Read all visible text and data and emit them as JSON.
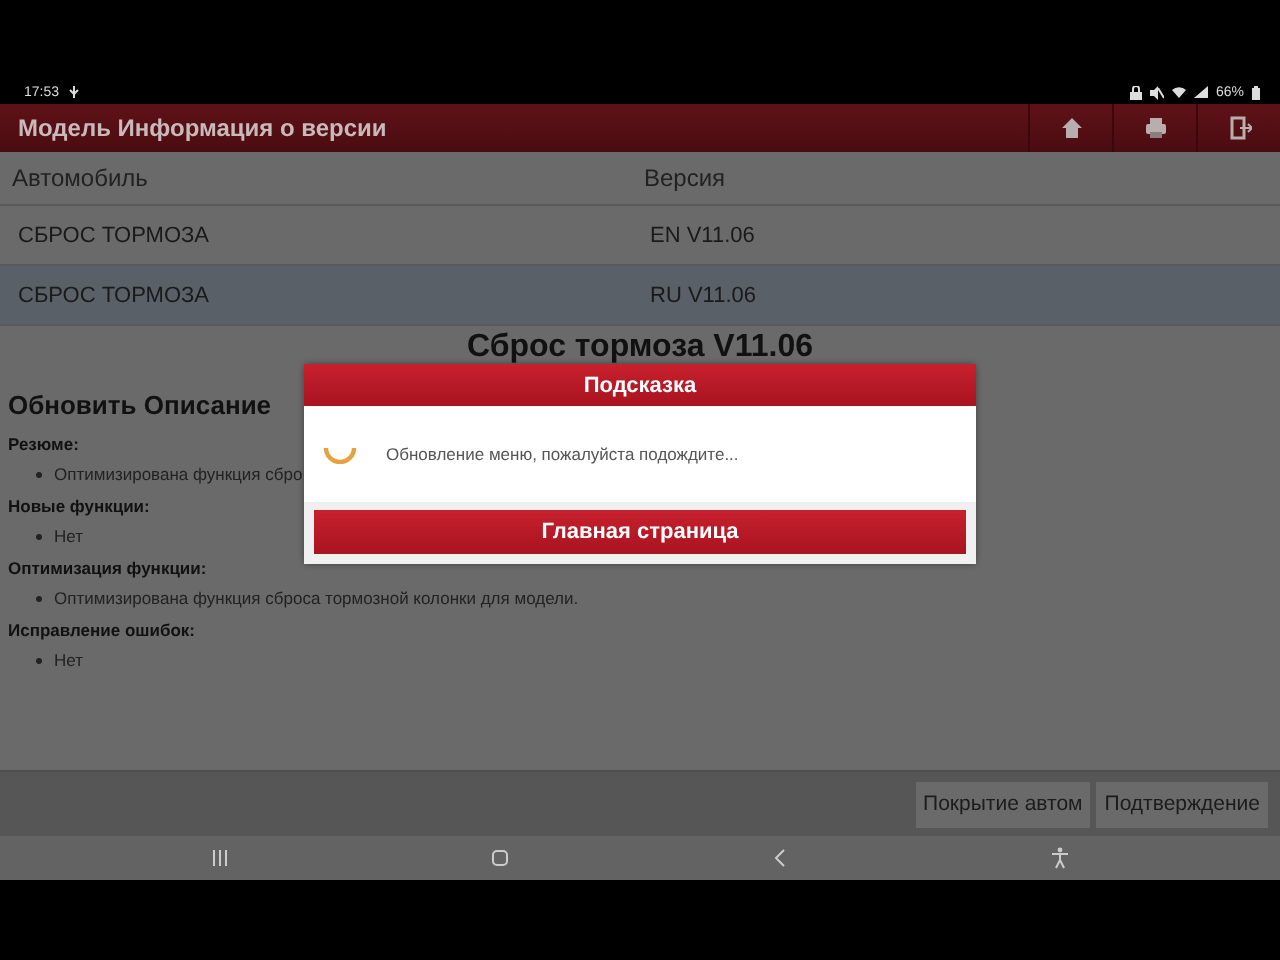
{
  "status_bar": {
    "time": "17:53",
    "battery": "66%"
  },
  "header": {
    "title": "Модель Информация о версии"
  },
  "table": {
    "columns": [
      "Автомобиль",
      "Версия"
    ],
    "rows": [
      {
        "cells": [
          "СБРОС ТОРМОЗА",
          "EN V11.06"
        ],
        "selected": false
      },
      {
        "cells": [
          "СБРОС ТОРМОЗА",
          "RU V11.06"
        ],
        "selected": true
      }
    ]
  },
  "notes": {
    "title": "Сброс тормоза V11.06",
    "heading": "Обновить Описание",
    "sections": [
      {
        "label": "Резюме:",
        "items": [
          "Оптимизирована функция сбро"
        ]
      },
      {
        "label": "Новые функции:",
        "items": [
          "Нет"
        ]
      },
      {
        "label": "Оптимизация функции:",
        "items": [
          "Оптимизирована функция сброса тормозной колонки для модели."
        ]
      },
      {
        "label": "Исправление ошибок:",
        "items": [
          "Нет"
        ]
      }
    ]
  },
  "bottom_bar": {
    "buttons": [
      "Покрытие автом",
      "Подтверждение"
    ]
  },
  "dialog": {
    "title": "Подсказка",
    "message": "Обновление меню, пожалуйста подождите...",
    "button": "Главная страница"
  }
}
